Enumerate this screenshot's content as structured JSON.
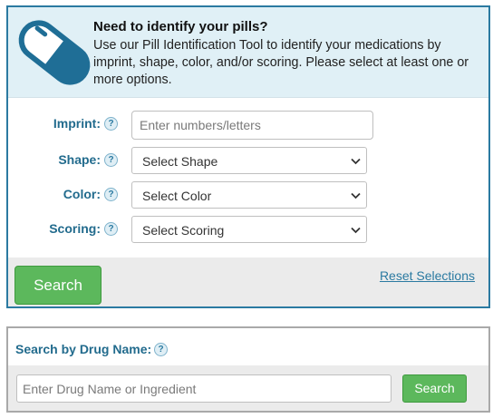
{
  "pill_identifier": {
    "title": "Need to identify your pills?",
    "description": "Use our Pill Identification Tool to identify your medications by imprint, shape, color, and/or scoring. Please select at least one or more options.",
    "icon": "pill-capsule-icon",
    "help_glyph": "?",
    "fields": {
      "imprint": {
        "label": "Imprint:",
        "placeholder": "Enter numbers/letters",
        "value": ""
      },
      "shape": {
        "label": "Shape:",
        "selected": "Select Shape"
      },
      "color": {
        "label": "Color:",
        "selected": "Select Color"
      },
      "scoring": {
        "label": "Scoring:",
        "selected": "Select Scoring"
      }
    },
    "search_label": "Search",
    "reset_label": "Reset Selections"
  },
  "drug_search": {
    "title": "Search by Drug Name:",
    "help_glyph": "?",
    "placeholder": "Enter Drug Name or Ingredient",
    "value": "",
    "search_label": "Search"
  },
  "colors": {
    "accent": "#2b7aa1",
    "label": "#226b8d",
    "header_bg": "#e0f0f6",
    "button_green": "#5cb85c",
    "footer_bg": "#ebebeb"
  }
}
